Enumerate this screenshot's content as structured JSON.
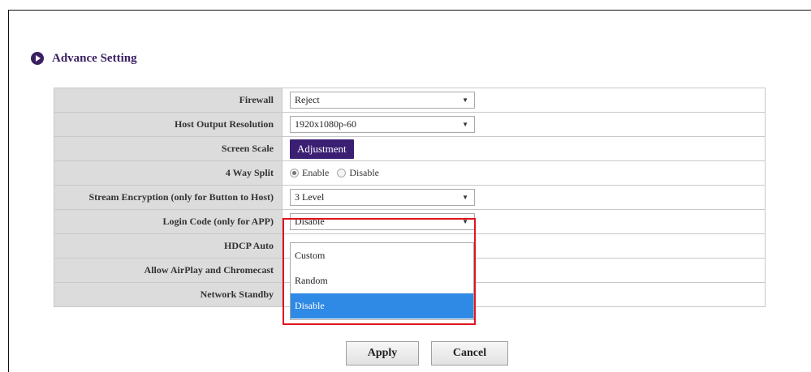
{
  "section": {
    "title": "Advance Setting"
  },
  "settings": {
    "firewall": {
      "label": "Firewall",
      "value": "Reject"
    },
    "host_output_resolution": {
      "label": "Host Output Resolution",
      "value": "1920x1080p-60"
    },
    "screen_scale": {
      "label": "Screen Scale",
      "button_label": "Adjustment"
    },
    "four_way_split": {
      "label": "4 Way Split",
      "options": [
        "Enable",
        "Disable"
      ],
      "selected": "Enable"
    },
    "stream_encryption": {
      "label": "Stream Encryption (only for Button to Host)",
      "value": "3 Level"
    },
    "login_code": {
      "label": "Login Code (only for APP)",
      "value": "Disable",
      "dropdown_open": true,
      "options": [
        "Custom",
        "Random",
        "Disable"
      ],
      "highlighted_option": "Disable"
    },
    "hdcp_auto": {
      "label": "HDCP Auto"
    },
    "allow_airplay": {
      "label": "Allow AirPlay and Chromecast"
    },
    "network_standby": {
      "label": "Network Standby"
    }
  },
  "buttons": {
    "apply": "Apply",
    "cancel": "Cancel"
  },
  "icons": {
    "section_bullet": "circle-play-icon",
    "select_caret": "caret-down-icon"
  },
  "colors": {
    "accent": "#3a2060",
    "button_purple": "#3b1f73",
    "highlight_border": "#e0141e",
    "selected_option": "#2f8ae5",
    "label_bg": "#dcdcdc"
  }
}
